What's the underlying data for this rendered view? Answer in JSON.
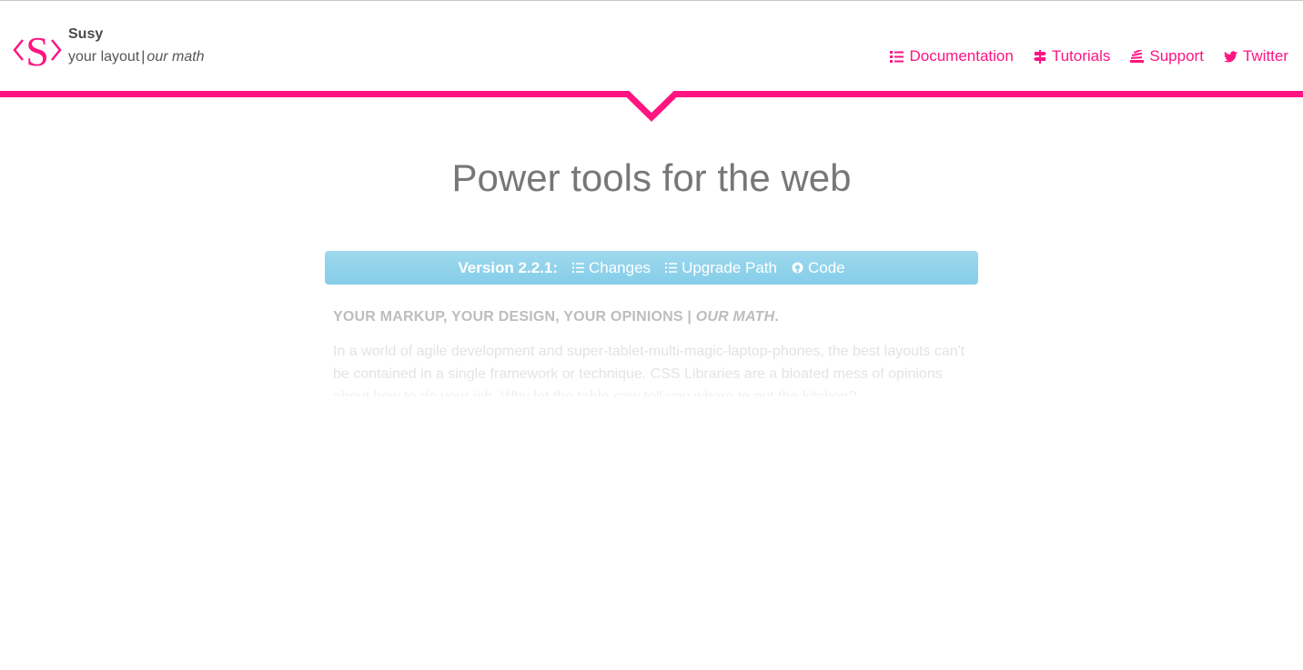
{
  "brand": {
    "name": "Susy",
    "tagline_main": "your layout",
    "tagline_sep": "|",
    "tagline_em": "our math",
    "logo_letter": "S"
  },
  "nav": {
    "items": [
      {
        "label": "Documentation",
        "icon": "list-icon"
      },
      {
        "label": "Tutorials",
        "icon": "signpost-icon"
      },
      {
        "label": "Support",
        "icon": "stack-icon"
      },
      {
        "label": "Twitter",
        "icon": "twitter-icon"
      }
    ]
  },
  "hero": {
    "title": "Power tools for the web"
  },
  "version_bar": {
    "version": "Version 2.2.1:",
    "links": [
      {
        "label": "Changes",
        "icon": "list-icon"
      },
      {
        "label": "Upgrade Path",
        "icon": "list-icon"
      },
      {
        "label": "Code",
        "icon": "github-icon"
      }
    ]
  },
  "intro": {
    "heading_main": "YOUR MARKUP, YOUR DESIGN, YOUR OPINIONS | ",
    "heading_em": "OUR MATH",
    "heading_end": ".",
    "paragraph": "In a world of agile development and super-tablet-multi-magic-laptop-phones, the best layouts can't be contained in a single framework or technique. CSS Libraries are a bloated mess of opinions about how to do your job. Why let the table-saw tell you where to put the kitchen?"
  },
  "colors": {
    "accent": "#ff1481",
    "version_bar": "#8fd2eb",
    "title": "#777777"
  }
}
